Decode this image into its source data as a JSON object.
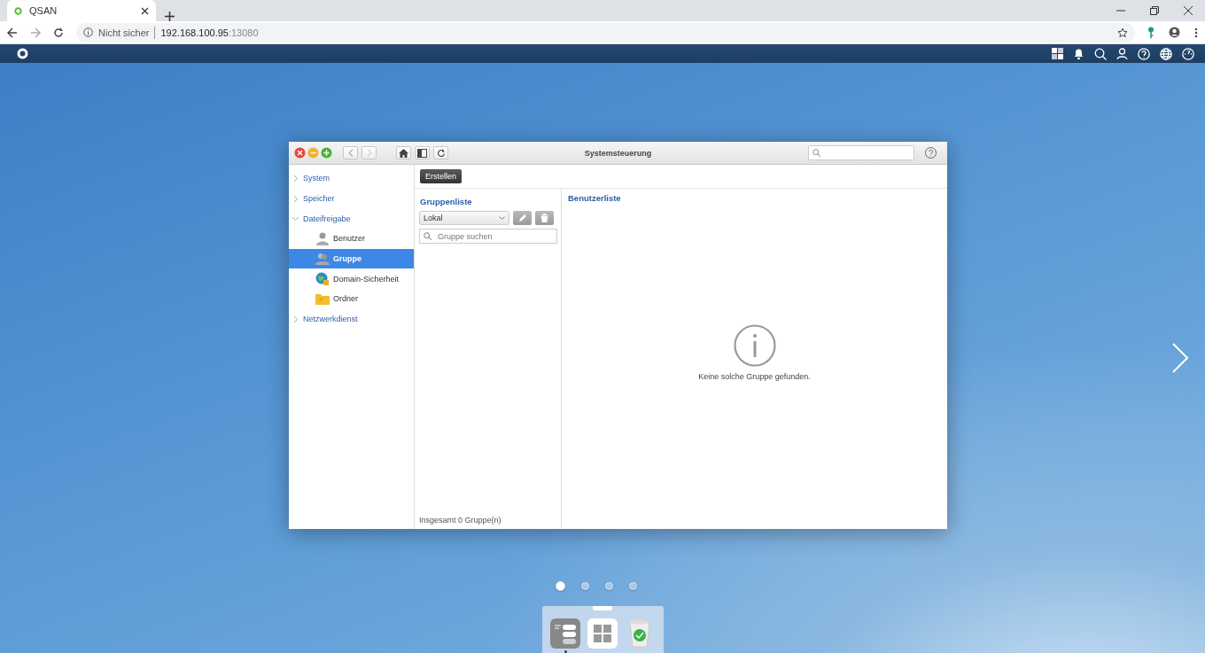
{
  "browser": {
    "tab": {
      "title": "QSAN"
    },
    "address": {
      "security": "Nicht sicher",
      "host": "192.168.100.95",
      "port": ":13080"
    }
  },
  "window": {
    "title": "Systemsteuerung",
    "toolbar": {
      "create_button": "Erstellen"
    },
    "sidebar": {
      "items": [
        {
          "label": "System",
          "expanded": false
        },
        {
          "label": "Speicher",
          "expanded": false
        },
        {
          "label": "Dateifreigabe",
          "expanded": true,
          "children": [
            {
              "label": "Benutzer",
              "kind": "user",
              "selected": false
            },
            {
              "label": "Gruppe",
              "kind": "group",
              "selected": true
            },
            {
              "label": "Domain-Sicherheit",
              "kind": "domain",
              "selected": false
            },
            {
              "label": "Ordner",
              "kind": "folder",
              "selected": false
            }
          ]
        },
        {
          "label": "Netzwerkdienst",
          "expanded": false
        }
      ]
    },
    "group_panel": {
      "title": "Gruppenliste",
      "source": "Lokal",
      "search": {
        "placeholder": "Gruppe suchen"
      },
      "footer": "Insgesamt 0 Gruppe(n)"
    },
    "user_panel": {
      "title": "Benutzerliste",
      "empty_message": "Keine solche Gruppe gefunden."
    }
  },
  "pager": [
    {
      "selected": true
    },
    {
      "selected": false
    },
    {
      "selected": false
    },
    {
      "selected": false
    }
  ],
  "dock": [
    {
      "kind": "settings",
      "running": true
    },
    {
      "kind": "apps",
      "running": false
    },
    {
      "kind": "trash",
      "running": false
    }
  ]
}
